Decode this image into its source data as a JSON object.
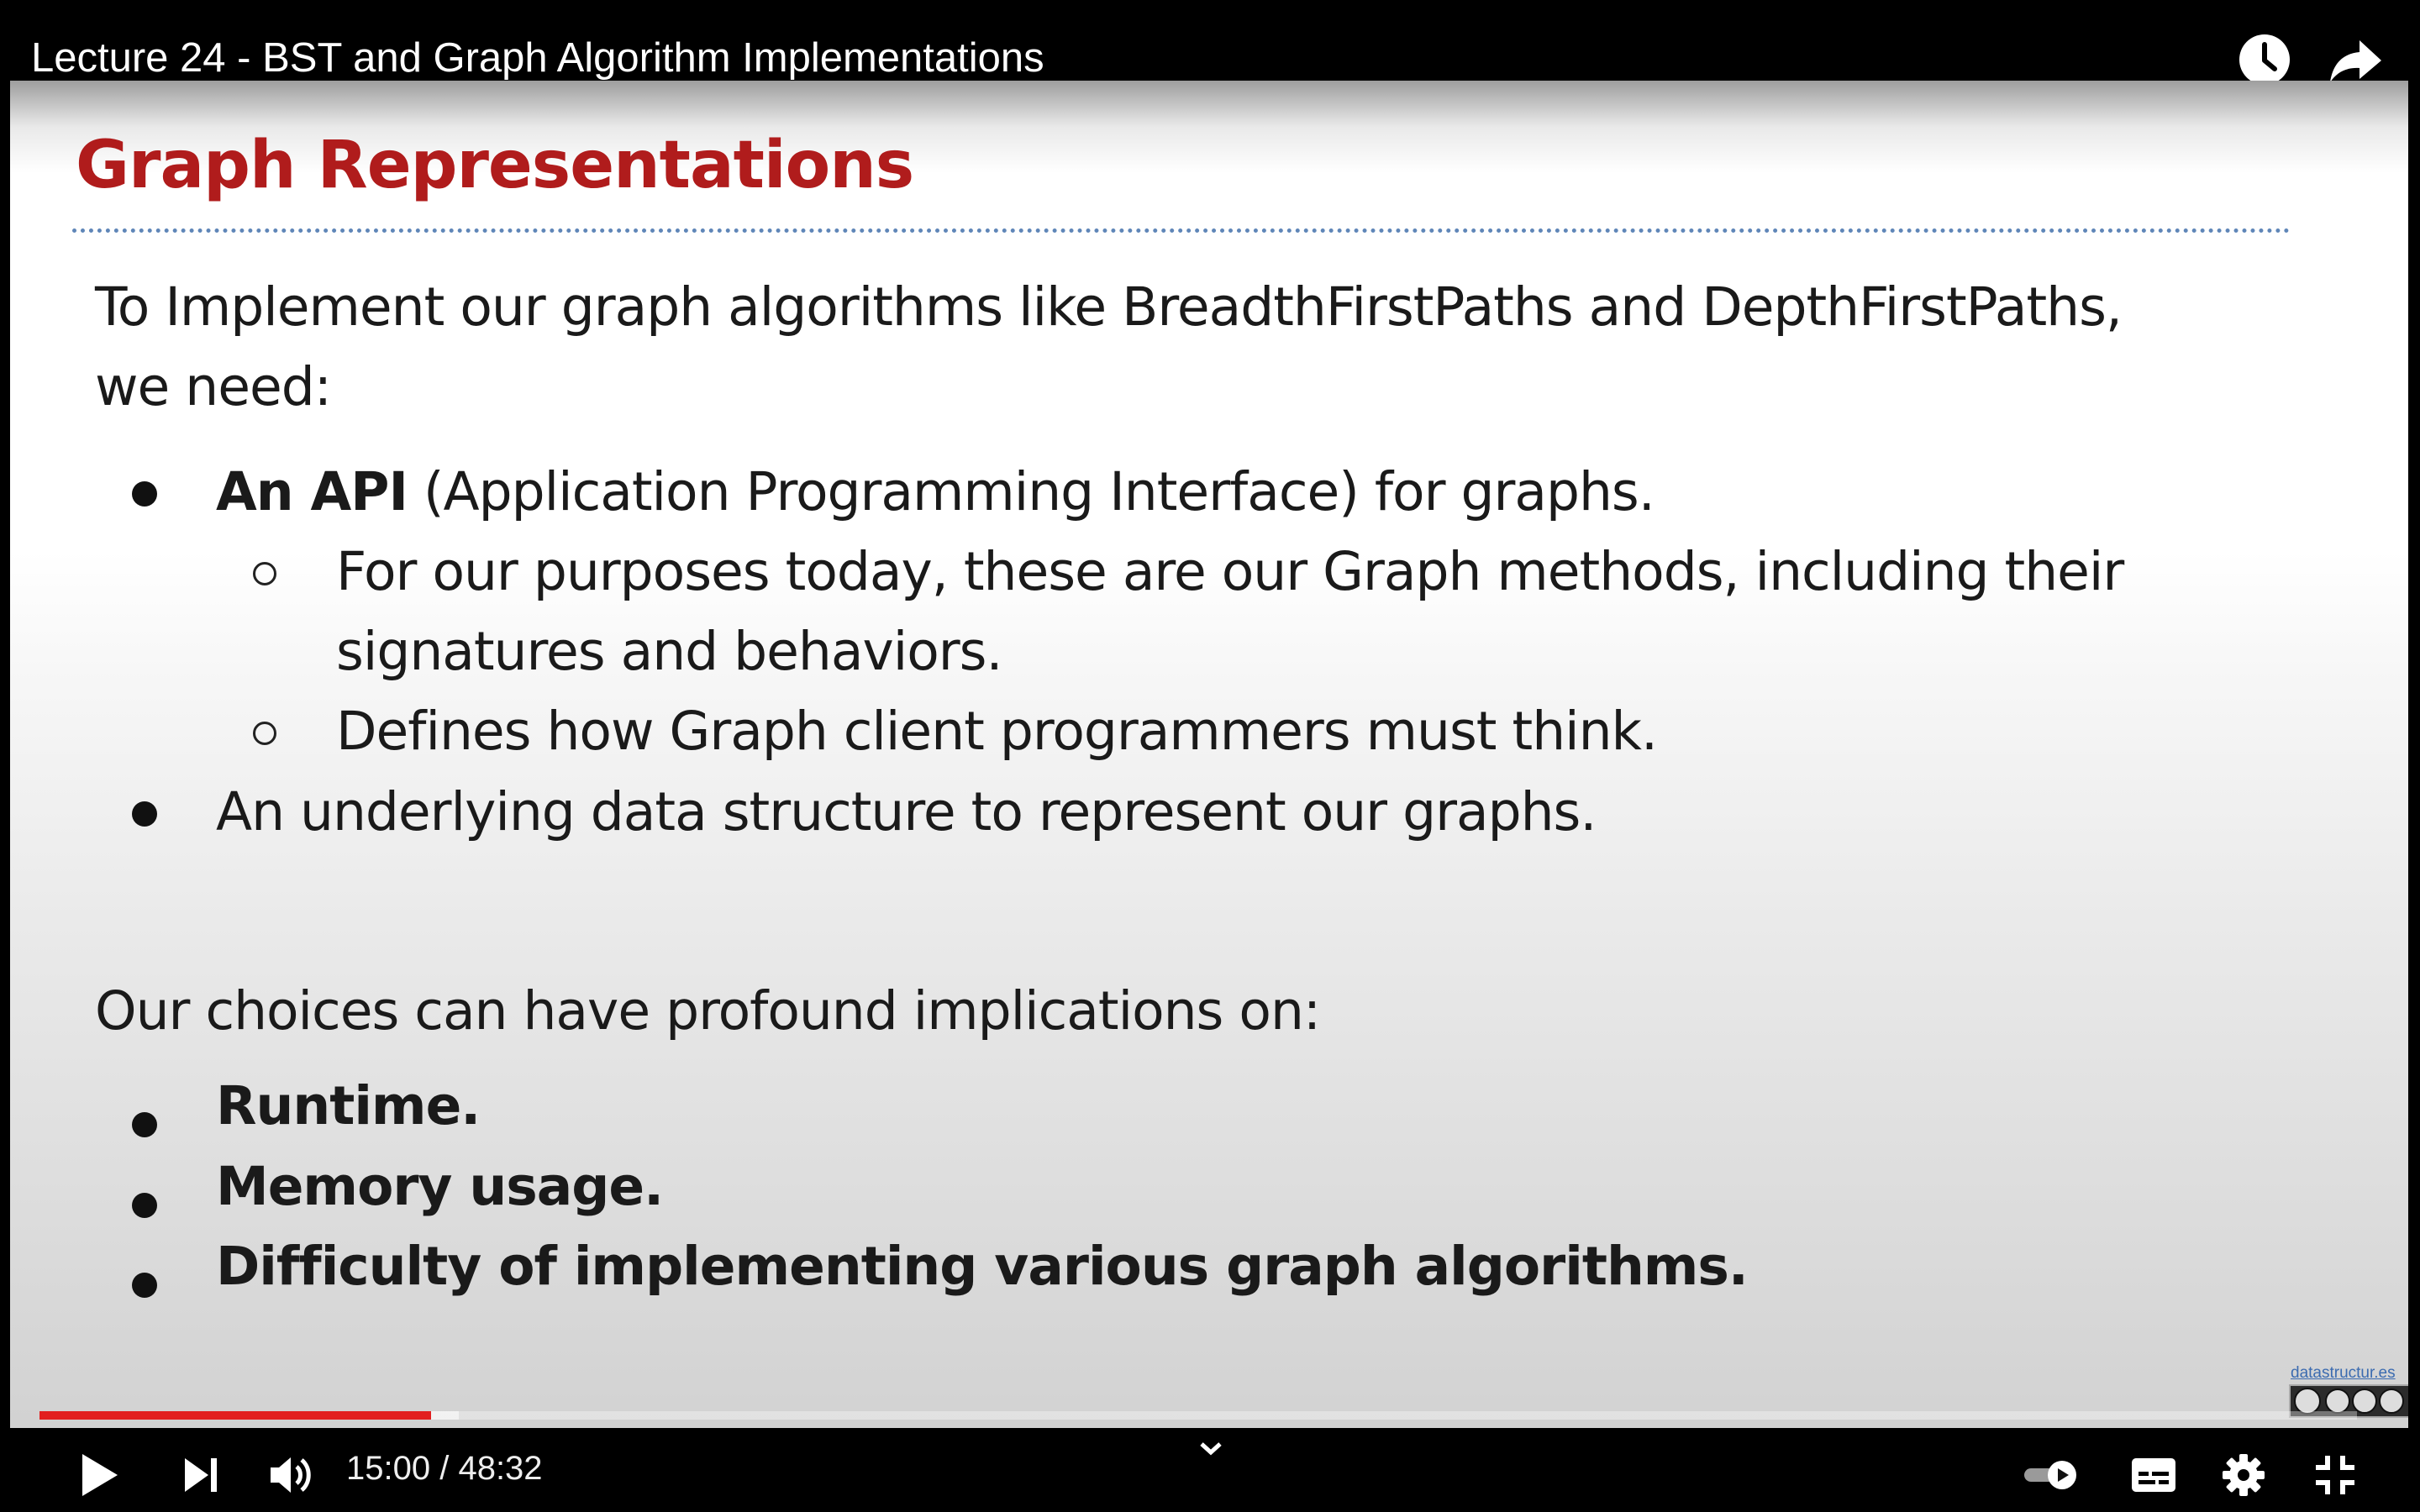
{
  "player": {
    "title": "Lecture 24 - BST and Graph Algorithm Implementations",
    "current_time": "15:00",
    "time_separator": " / ",
    "duration": "48:32",
    "progress": {
      "played_fraction": 0.169,
      "buffered_fraction": 0.181
    },
    "accent_color": "#e21f1f",
    "icons": {
      "watch_later": "clock-icon",
      "share": "share-icon",
      "play": "play-icon",
      "next": "next-icon",
      "volume": "volume-icon",
      "chapters": "chevron-down-icon",
      "autoplay": "autoplay-toggle-icon",
      "captions": "captions-icon",
      "settings": "gear-icon",
      "exit_fullscreen": "exit-fullscreen-icon"
    }
  },
  "slide": {
    "title": "Graph Representations",
    "title_color": "#b01c1c",
    "intro_line1": "To Implement our graph algorithms like BreadthFirstPaths and DepthFirstPaths,",
    "intro_line2": "we need:",
    "bullet1_bold": "An API",
    "bullet1_rest": " (Application Programming Interface) for graphs.",
    "sub1_line1": "For our purposes today, these are our Graph methods, including their",
    "sub1_line2": "signatures and behaviors.",
    "sub2": "Defines how Graph client programmers must think.",
    "bullet2": "An underlying data structure to represent our graphs.",
    "choices_intro": "Our choices can have profound implications on:",
    "choice1": "Runtime.",
    "choice2": "Memory usage.",
    "choice3": "Difficulty of implementing various graph algorithms.",
    "license_link": "datastructur.es"
  }
}
